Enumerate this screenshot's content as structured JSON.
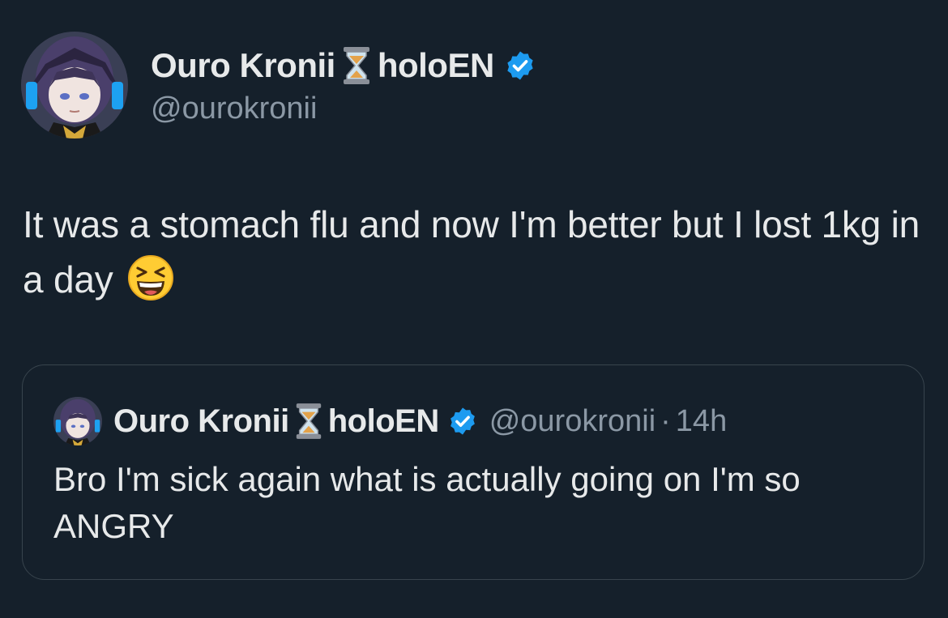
{
  "tweet": {
    "author": {
      "display_name": "Ouro Kronii",
      "name_suffix": "holoEN",
      "handle": "@ourokronii",
      "name_emoji": "hourglass-icon",
      "verified": true
    },
    "text": "It was a stomach flu and now I'm better but I lost 1kg in a day",
    "text_emoji": "grinning-squinting-face-emoji"
  },
  "quoted_tweet": {
    "author": {
      "display_name": "Ouro Kronii",
      "name_suffix": "holoEN",
      "handle": "@ourokronii",
      "verified": true
    },
    "separator": "·",
    "time": "14h",
    "text": "Bro I'm sick again what is actually going on I'm so ANGRY"
  },
  "colors": {
    "background": "#15202b",
    "text_primary": "#e7e9ea",
    "text_secondary": "#8b98a5",
    "border": "#38444d",
    "verified_blue": "#1d9bf0"
  }
}
